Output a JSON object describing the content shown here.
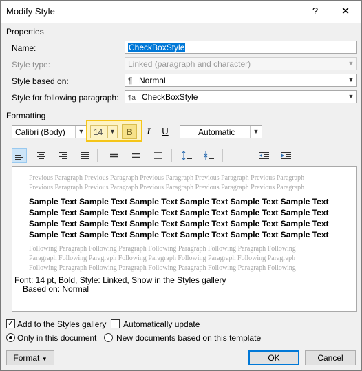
{
  "window": {
    "title": "Modify Style",
    "help": "?",
    "close": "✕"
  },
  "properties": {
    "section": "Properties",
    "name_label": "Name:",
    "name_value": "CheckBoxStyle",
    "type_label": "Style type:",
    "type_value": "Linked (paragraph and character)",
    "based_label": "Style based on:",
    "based_icon": "¶",
    "based_value": "Normal",
    "following_label": "Style for following paragraph:",
    "following_icon": "¶a",
    "following_value": "CheckBoxStyle"
  },
  "formatting": {
    "section": "Formatting",
    "font": "Calibri (Body)",
    "size": "14",
    "bold": "B",
    "italic": "I",
    "underline": "U",
    "color": "Automatic",
    "highlight_color": "#f5c518"
  },
  "preview": {
    "previous": "Previous Paragraph Previous Paragraph Previous Paragraph Previous Paragraph Previous Paragraph Previous Paragraph Previous Paragraph Previous Paragraph Previous Paragraph Previous Paragraph",
    "sample": "Sample Text Sample Text Sample Text Sample Text Sample Text Sample Text Sample Text Sample Text Sample Text Sample Text Sample Text Sample Text Sample Text Sample Text Sample Text Sample Text Sample Text Sample Text Sample Text Sample Text Sample Text Sample Text Sample Text Sample Text",
    "following": "Following Paragraph Following Paragraph Following Paragraph Following Paragraph Following Paragraph Following Paragraph Following Paragraph Following Paragraph Following Paragraph Following Paragraph Following Paragraph Following Paragraph Following Paragraph Following Paragraph Following Paragraph"
  },
  "description": {
    "line1": "Font: 14 pt, Bold, Style: Linked, Show in the Styles gallery",
    "line2": "Based on: Normal"
  },
  "options": {
    "add_gallery": "Add to the Styles gallery",
    "auto_update": "Automatically update",
    "only_doc": "Only in this document",
    "new_docs": "New documents based on this template"
  },
  "buttons": {
    "format": "Format",
    "ok": "OK",
    "cancel": "Cancel"
  }
}
